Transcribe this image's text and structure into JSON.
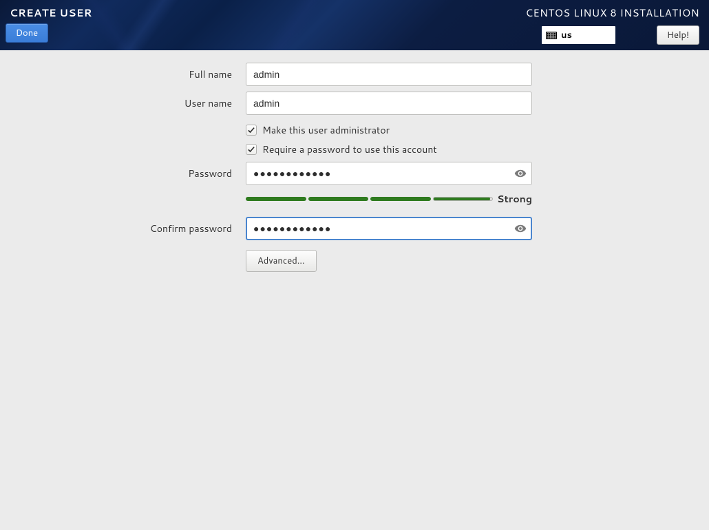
{
  "header": {
    "page_title": "CREATE USER",
    "installer_title": "CENTOS LINUX 8 INSTALLATION",
    "done_label": "Done",
    "help_label": "Help!",
    "keyboard_layout": "us"
  },
  "form": {
    "labels": {
      "full_name": "Full name",
      "user_name": "User name",
      "password": "Password",
      "confirm_password": "Confirm password"
    },
    "values": {
      "full_name": "admin",
      "user_name": "admin",
      "password_masked": "●●●●●●●●●●●●",
      "confirm_password_masked": "●●●●●●●●●●●●"
    },
    "checkboxes": {
      "make_admin": {
        "label": "Make this user administrator",
        "checked": true
      },
      "require_password": {
        "label": "Require a password to use this account",
        "checked": true
      }
    },
    "password_strength": {
      "level": 4,
      "label": "Strong"
    },
    "advanced_label": "Advanced..."
  }
}
